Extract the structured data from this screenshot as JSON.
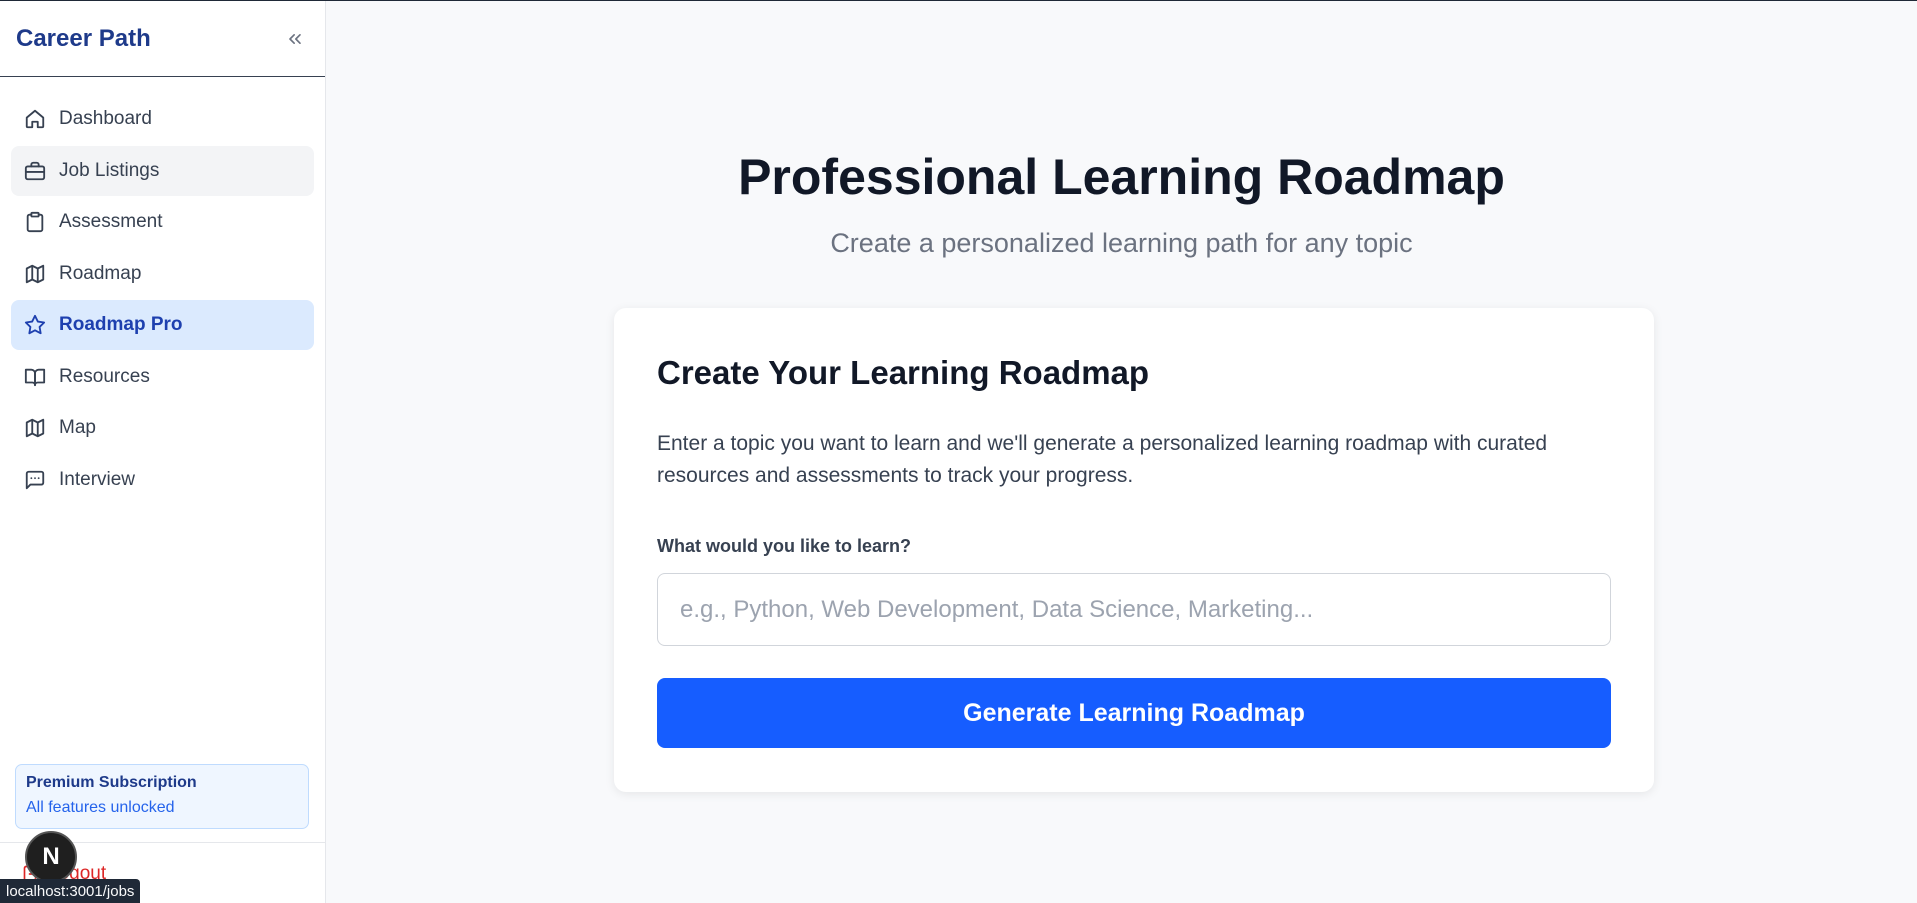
{
  "sidebar": {
    "brand": "Career Path",
    "items": [
      {
        "label": "Dashboard",
        "icon": "home-icon"
      },
      {
        "label": "Job Listings",
        "icon": "briefcase-icon"
      },
      {
        "label": "Assessment",
        "icon": "clipboard-icon"
      },
      {
        "label": "Roadmap",
        "icon": "map-icon"
      },
      {
        "label": "Roadmap Pro",
        "icon": "star-icon"
      },
      {
        "label": "Resources",
        "icon": "book-icon"
      },
      {
        "label": "Map",
        "icon": "map-icon"
      },
      {
        "label": "Interview",
        "icon": "message-icon"
      }
    ],
    "active_item": "Roadmap Pro",
    "hovered_item": "Job Listings",
    "premium": {
      "title": "Premium Subscription",
      "subtitle": "All features unlocked"
    },
    "logout_label": "Logout"
  },
  "main": {
    "title": "Professional Learning Roadmap",
    "subtitle": "Create a personalized learning path for any topic",
    "card": {
      "title": "Create Your Learning Roadmap",
      "description": "Enter a topic you want to learn and we'll generate a personalized learning roadmap with curated resources and assessments to track your progress.",
      "field_label": "What would you like to learn?",
      "input_placeholder": "e.g., Python, Web Development, Data Science, Marketing...",
      "input_value": "",
      "button_label": "Generate Learning Roadmap"
    }
  },
  "overlay": {
    "next_badge": "N",
    "status_url": "localhost:3001/jobs"
  },
  "colors": {
    "accent": "#165dff",
    "brand": "#1e3a8a",
    "active_bg": "#dbeafe",
    "logout": "#dc2626"
  }
}
